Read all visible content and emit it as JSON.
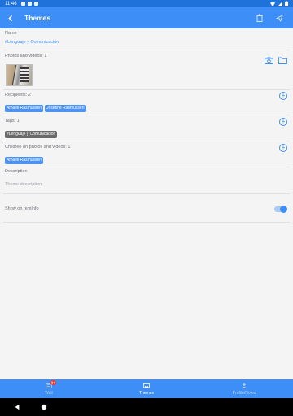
{
  "status_bar": {
    "time": "11:46"
  },
  "app_bar": {
    "title": "Themes"
  },
  "name_section": {
    "label": "Name",
    "value": "#Lenguaje y Comunicación"
  },
  "photos_section": {
    "label": "Photos and videos: 1"
  },
  "recipients_section": {
    "label": "Recipients: 2",
    "chips": [
      "Amalie Rasmussen",
      "Josefine Rasmussen"
    ]
  },
  "tags_section": {
    "label": "Tags: 1",
    "chips": [
      "#Lenguaje y Comunicación"
    ]
  },
  "children_section": {
    "label": "Children on photos and videos: 1",
    "chips": [
      "Amalie Rasmussen"
    ]
  },
  "description_section": {
    "label": "Description",
    "placeholder": "Theme description"
  },
  "show_section": {
    "label": "Show on remInfo",
    "toggle_on": true
  },
  "tabbar": {
    "tabs": [
      {
        "label": "Wall",
        "badge": "9+",
        "active": false
      },
      {
        "label": "Themes",
        "active": true
      },
      {
        "label": "Profile/Notes",
        "active": false
      }
    ]
  },
  "colors": {
    "primary": "#3d8ef6",
    "status_bar": "#1f72d9",
    "chip_blue": "#4e93f1",
    "chip_gray": "#6a6a6a",
    "badge": "#e53935"
  }
}
